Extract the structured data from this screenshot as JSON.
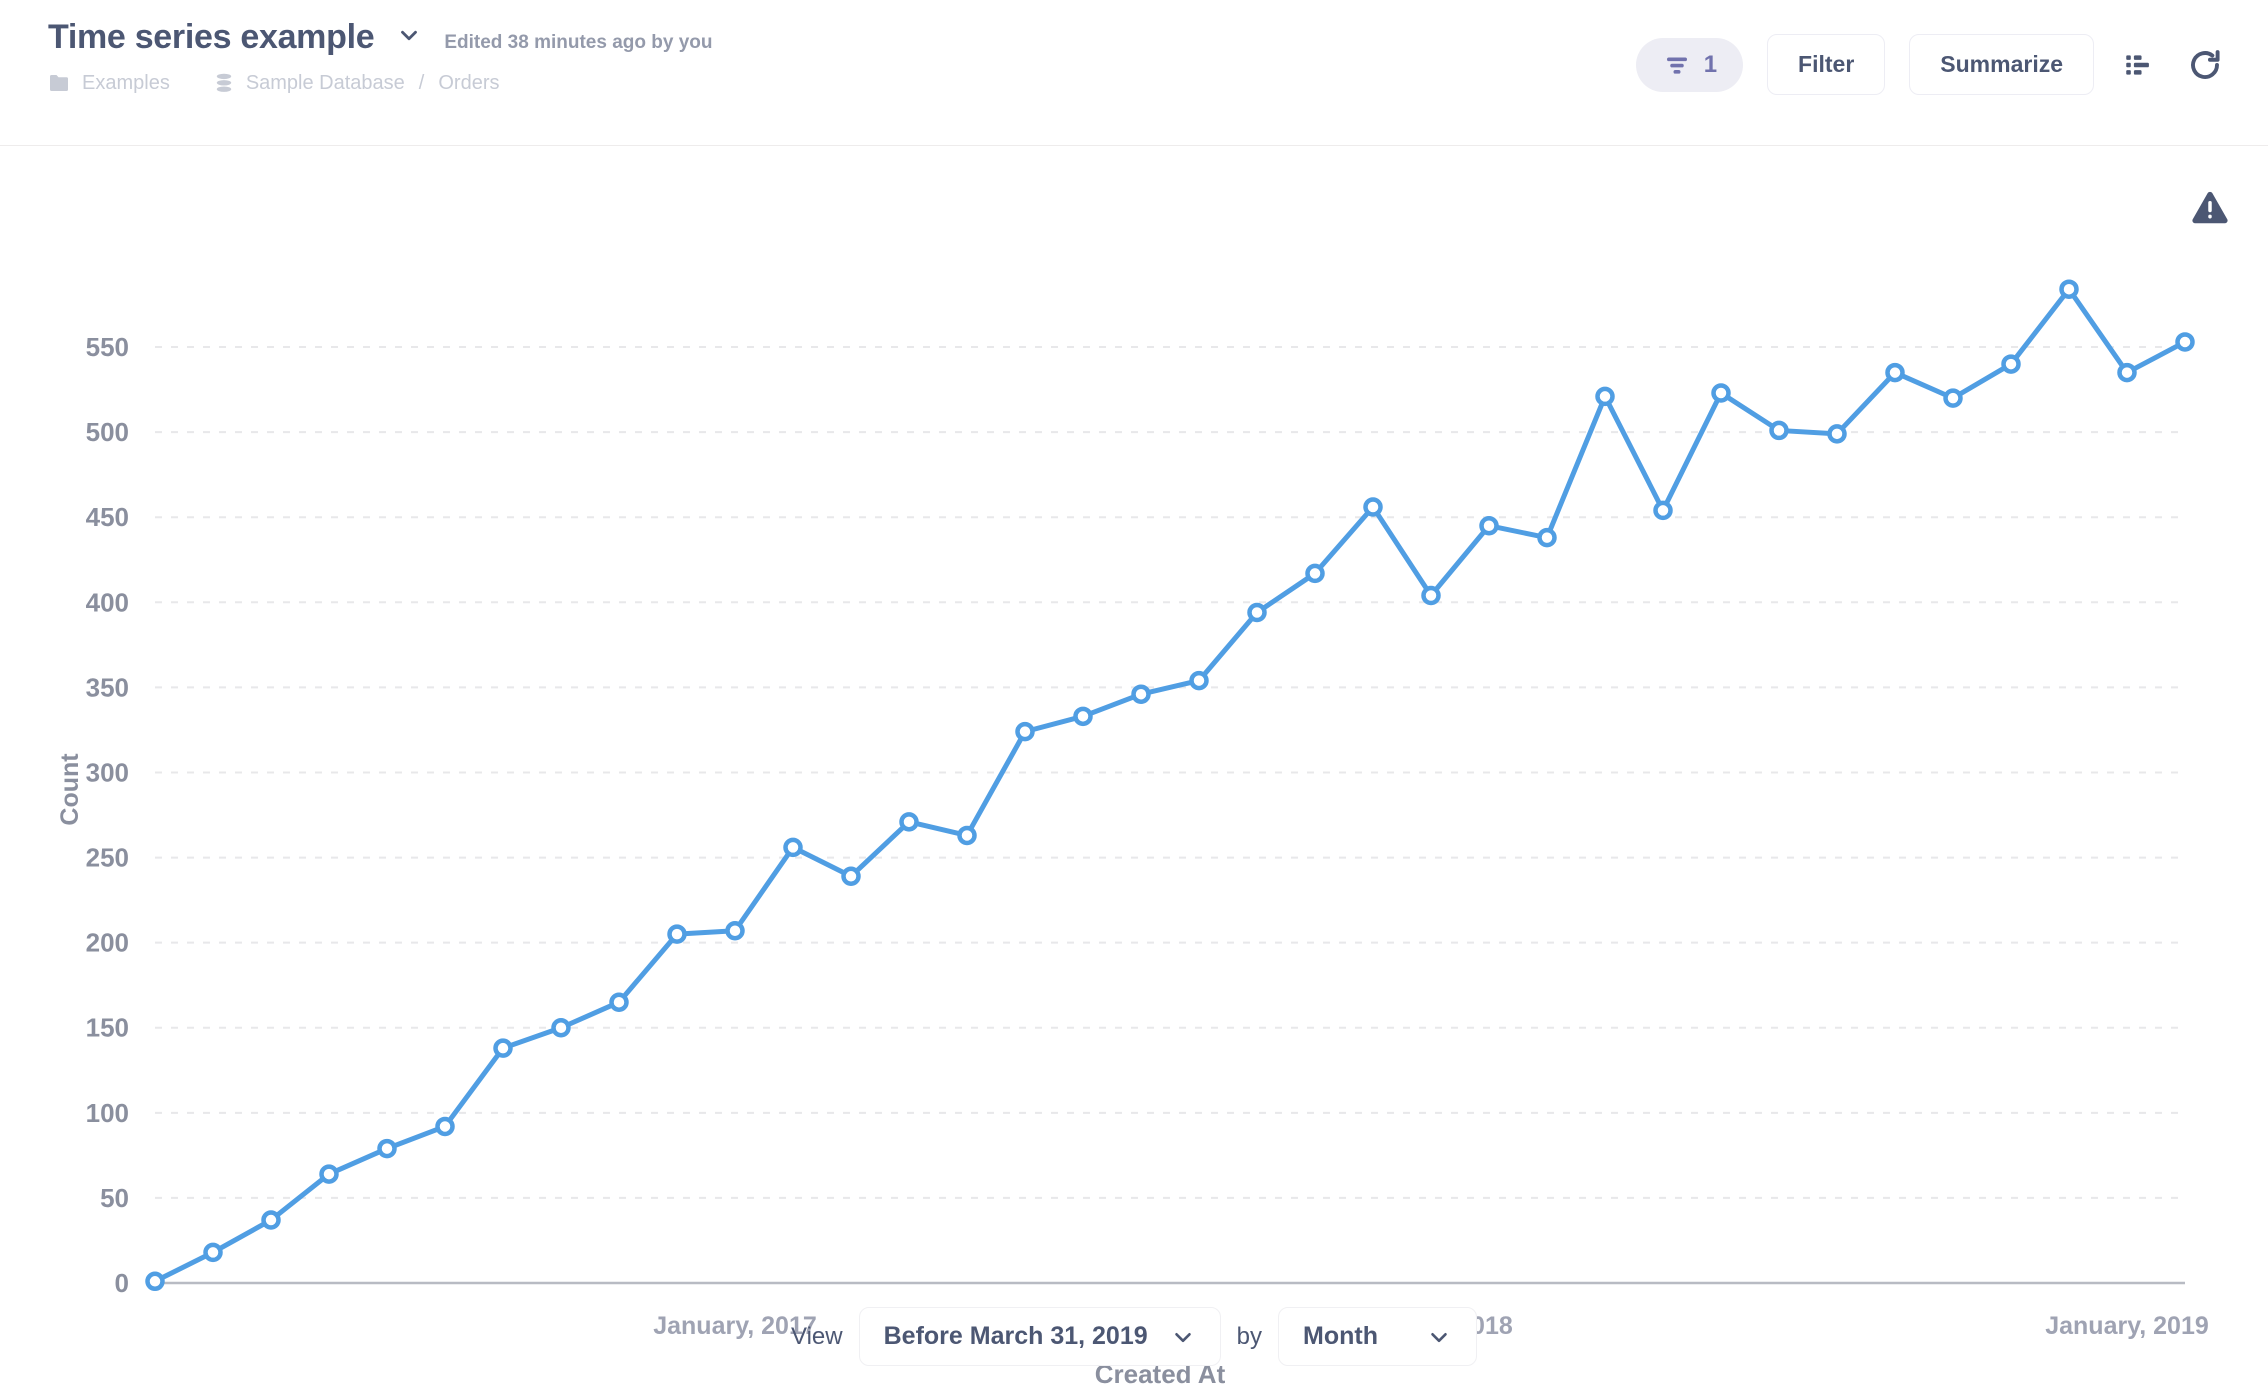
{
  "header": {
    "title": "Time series example",
    "title_caret_icon": "chevron-down-icon",
    "edited": "Edited 38 minutes ago by you",
    "breadcrumb": {
      "collection_icon": "folder-icon",
      "collection": "Examples",
      "database_icon": "database-icon",
      "database": "Sample Database",
      "separator": "/",
      "table": "Orders"
    },
    "toolbar": {
      "filter_badge_icon": "filter-icon",
      "filter_badge_count": "1",
      "filter_label": "Filter",
      "summarize_label": "Summarize",
      "table_view_icon": "table-view-icon",
      "refresh_icon": "refresh-icon"
    }
  },
  "chart_warning_icon": "warning-triangle-icon",
  "footer": {
    "view_label": "View",
    "date_range_value": "Before March 31, 2019",
    "by_label": "by",
    "bucket_value": "Month",
    "chevron_icon": "chevron-down-icon"
  },
  "colors": {
    "line": "#509EE3",
    "text_dark": "#4C5773",
    "text_muted": "#949AAB",
    "breadcrumb": "#C7CBD5",
    "accent_badge_bg": "#EDEDF4",
    "accent_badge_fg": "#7172AD",
    "grid": "#E8E8EA",
    "axis": "#B8BBC3"
  },
  "chart_data": {
    "type": "line",
    "title": "",
    "xlabel": "Created At",
    "ylabel": "Count",
    "ylim": [
      0,
      580
    ],
    "yticks": [
      0,
      50,
      100,
      150,
      200,
      250,
      300,
      350,
      400,
      450,
      500,
      550
    ],
    "xtick_labels": [
      "January, 2017",
      "January, 2018",
      "January, 2019"
    ],
    "xtick_indices": [
      10,
      22,
      34
    ],
    "grid": true,
    "legend": "none",
    "marker": "open-circle",
    "x": [
      "April, 2016",
      "May, 2016",
      "June, 2016",
      "July, 2016",
      "August, 2016",
      "September, 2016",
      "October, 2016",
      "November, 2016",
      "December, 2016",
      "January, 2017",
      "February, 2017",
      "March, 2017",
      "April, 2017",
      "May, 2017",
      "June, 2017",
      "July, 2017",
      "August, 2017",
      "September, 2017",
      "October, 2017",
      "November, 2017",
      "December, 2017",
      "January, 2018",
      "February, 2018",
      "March, 2018",
      "April, 2018",
      "May, 2018",
      "June, 2018",
      "July, 2018",
      "August, 2018",
      "September, 2018",
      "October, 2018",
      "November, 2018",
      "December, 2018",
      "January, 2019",
      "February, 2019",
      "March, 2019"
    ],
    "values": [
      1,
      18,
      37,
      64,
      79,
      92,
      138,
      150,
      165,
      205,
      207,
      256,
      239,
      271,
      263,
      324,
      333,
      346,
      354,
      394,
      417,
      456,
      404,
      445,
      438,
      521,
      454,
      523,
      501,
      499,
      535,
      520,
      540,
      584,
      535,
      553
    ],
    "series": [
      {
        "name": "Count",
        "color": "#509EE3"
      }
    ]
  }
}
